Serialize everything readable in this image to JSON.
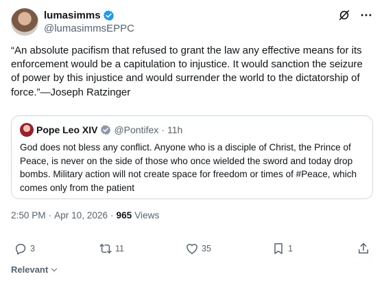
{
  "colors": {
    "accent": "#1d9bf0",
    "text": "#0f1419",
    "secondary": "#536471",
    "border": "#cfd9de"
  },
  "author": {
    "display_name": "lumasimms",
    "handle": "@lumasimmsEPPC",
    "verified_icon": "verified-badge-icon"
  },
  "header_actions": [
    {
      "icon": "grok-icon"
    },
    {
      "icon": "more-icon"
    }
  ],
  "tweet": {
    "text": "“An absolute pacifism that refused to grant the law any effective means for its enforcement would be a capitulation to injustice. It would sanction the seizure of power by this injustice and would surrender the world to the dictatorship of force.”—Joseph Ratzinger"
  },
  "quote": {
    "display_name": "Pope Leo XIV",
    "handle": "@Pontifex",
    "separator": "·",
    "time": "11h",
    "verified_icon": "verified-gray-badge-icon",
    "text": "God does not bless any conflict. Anyone who is a disciple of Christ, the Prince of Peace, is never on the side of those who once wielded the sword and today drop bombs. Military action will not create space for freedom or times of #Peace, which comes only from the patient"
  },
  "meta": {
    "time": "2:50 PM",
    "dot": "·",
    "date": "Apr 10, 2026",
    "dot2": "·",
    "views_count": "965",
    "views_label": "Views"
  },
  "actions": {
    "reply_count": "3",
    "repost_count": "11",
    "like_count": "35",
    "bookmark_count": "1",
    "share_icon": "share-icon"
  },
  "sort": {
    "label": "Relevant"
  }
}
